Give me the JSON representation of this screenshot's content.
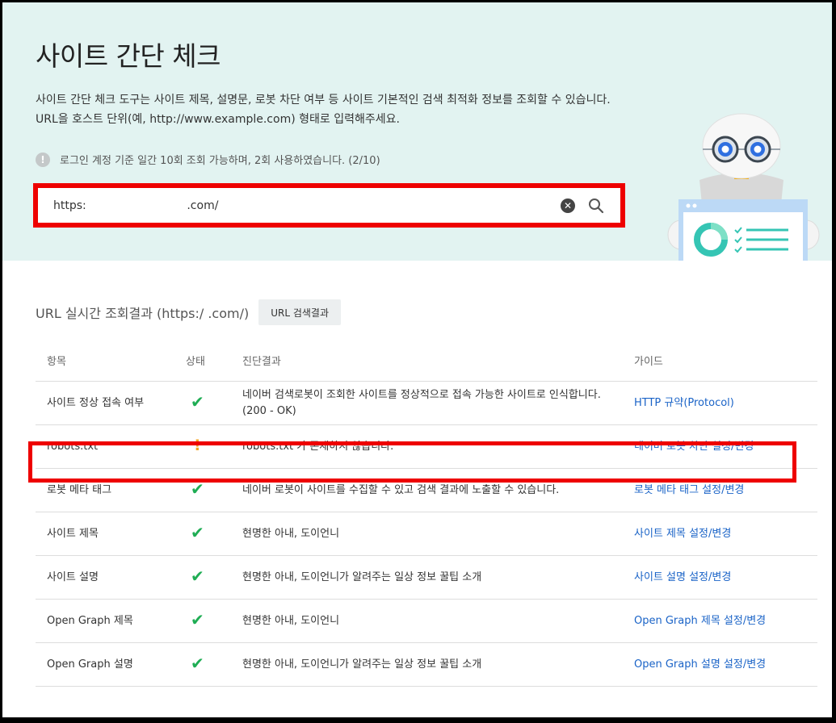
{
  "page_title": "사이트 간단 체크",
  "description_line1": "사이트 간단 체크 도구는 사이트 제목, 설명문, 로봇 차단 여부 등 사이트 기본적인 검색 최적화 정보를 조회할 수 있습니다.",
  "description_line2": "URL을 호스트 단위(예, http://www.example.com) 형태로 입력해주세요.",
  "notice": {
    "icon": "info-icon",
    "text": "로그인 계정 기준 일간 10회 조회 가능하며, 2회 사용하였습니다. (2/10)"
  },
  "search": {
    "value": "https:                            .com/",
    "clear_icon": "clear-icon",
    "search_icon": "search-icon"
  },
  "result_header": {
    "title": "URL 실시간 조회결과 (https:/                                   .com/)",
    "button_label": "URL 검색결과"
  },
  "table": {
    "columns": [
      "항목",
      "상태",
      "진단결과",
      "가이드"
    ],
    "rows": [
      {
        "item": "사이트 정상 접속 여부",
        "status": "ok",
        "result_line1": "네이버 검색로봇이 조회한 사이트를 정상적으로 접속 가능한 사이트로 인식합니다.",
        "result_line2": "(200 - OK)",
        "guide": "HTTP 규약(Protocol)"
      },
      {
        "item": "robots.txt",
        "status": "warning",
        "result_line1": "robots.txt 가 존재하지 않습니다.",
        "result_line2": "",
        "guide": "네이버 로봇 차단 설정/변경"
      },
      {
        "item": "로봇 메타 태그",
        "status": "ok",
        "result_line1": "네이버 로봇이 사이트를 수집할 수 있고 검색 결과에 노출할 수 있습니다.",
        "result_line2": "",
        "guide": "로봇 메타 태그 설정/변경"
      },
      {
        "item": "사이트 제목",
        "status": "ok",
        "result_line1": "현명한 아내, 도이언니",
        "result_line2": "",
        "guide": "사이트 제목 설정/변경"
      },
      {
        "item": "사이트 설명",
        "status": "ok",
        "result_line1": "현명한 아내, 도이언니가 알려주는 일상 정보 꿀팁 소개",
        "result_line2": "",
        "guide": "사이트 설명 설정/변경"
      },
      {
        "item": "Open Graph 제목",
        "status": "ok",
        "result_line1": "현명한 아내, 도이언니",
        "result_line2": "",
        "guide": "Open Graph 제목 설정/변경"
      },
      {
        "item": "Open Graph 설명",
        "status": "ok",
        "result_line1": "현명한 아내, 도이언니가 알려주는 일상 정보 꿀팁 소개",
        "result_line2": "",
        "guide": "Open Graph 설명 설정/변경"
      }
    ]
  },
  "icons": {
    "ok": "check-icon",
    "warning": "warning-icon"
  },
  "colors": {
    "hero_bg": "#e2f3f1",
    "highlight": "#ee0000",
    "link": "#1a63c7",
    "ok": "#1fad54",
    "warning": "#f5a623"
  }
}
